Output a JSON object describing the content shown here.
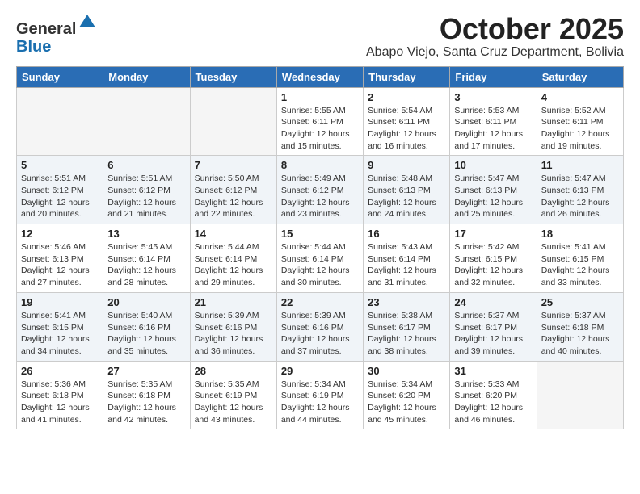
{
  "logo": {
    "general": "General",
    "blue": "Blue"
  },
  "title": "October 2025",
  "location": "Abapo Viejo, Santa Cruz Department, Bolivia",
  "days_of_week": [
    "Sunday",
    "Monday",
    "Tuesday",
    "Wednesday",
    "Thursday",
    "Friday",
    "Saturday"
  ],
  "weeks": [
    [
      {
        "day": "",
        "info": ""
      },
      {
        "day": "",
        "info": ""
      },
      {
        "day": "",
        "info": ""
      },
      {
        "day": "1",
        "info": "Sunrise: 5:55 AM\nSunset: 6:11 PM\nDaylight: 12 hours\nand 15 minutes."
      },
      {
        "day": "2",
        "info": "Sunrise: 5:54 AM\nSunset: 6:11 PM\nDaylight: 12 hours\nand 16 minutes."
      },
      {
        "day": "3",
        "info": "Sunrise: 5:53 AM\nSunset: 6:11 PM\nDaylight: 12 hours\nand 17 minutes."
      },
      {
        "day": "4",
        "info": "Sunrise: 5:52 AM\nSunset: 6:11 PM\nDaylight: 12 hours\nand 19 minutes."
      }
    ],
    [
      {
        "day": "5",
        "info": "Sunrise: 5:51 AM\nSunset: 6:12 PM\nDaylight: 12 hours\nand 20 minutes."
      },
      {
        "day": "6",
        "info": "Sunrise: 5:51 AM\nSunset: 6:12 PM\nDaylight: 12 hours\nand 21 minutes."
      },
      {
        "day": "7",
        "info": "Sunrise: 5:50 AM\nSunset: 6:12 PM\nDaylight: 12 hours\nand 22 minutes."
      },
      {
        "day": "8",
        "info": "Sunrise: 5:49 AM\nSunset: 6:12 PM\nDaylight: 12 hours\nand 23 minutes."
      },
      {
        "day": "9",
        "info": "Sunrise: 5:48 AM\nSunset: 6:13 PM\nDaylight: 12 hours\nand 24 minutes."
      },
      {
        "day": "10",
        "info": "Sunrise: 5:47 AM\nSunset: 6:13 PM\nDaylight: 12 hours\nand 25 minutes."
      },
      {
        "day": "11",
        "info": "Sunrise: 5:47 AM\nSunset: 6:13 PM\nDaylight: 12 hours\nand 26 minutes."
      }
    ],
    [
      {
        "day": "12",
        "info": "Sunrise: 5:46 AM\nSunset: 6:13 PM\nDaylight: 12 hours\nand 27 minutes."
      },
      {
        "day": "13",
        "info": "Sunrise: 5:45 AM\nSunset: 6:14 PM\nDaylight: 12 hours\nand 28 minutes."
      },
      {
        "day": "14",
        "info": "Sunrise: 5:44 AM\nSunset: 6:14 PM\nDaylight: 12 hours\nand 29 minutes."
      },
      {
        "day": "15",
        "info": "Sunrise: 5:44 AM\nSunset: 6:14 PM\nDaylight: 12 hours\nand 30 minutes."
      },
      {
        "day": "16",
        "info": "Sunrise: 5:43 AM\nSunset: 6:14 PM\nDaylight: 12 hours\nand 31 minutes."
      },
      {
        "day": "17",
        "info": "Sunrise: 5:42 AM\nSunset: 6:15 PM\nDaylight: 12 hours\nand 32 minutes."
      },
      {
        "day": "18",
        "info": "Sunrise: 5:41 AM\nSunset: 6:15 PM\nDaylight: 12 hours\nand 33 minutes."
      }
    ],
    [
      {
        "day": "19",
        "info": "Sunrise: 5:41 AM\nSunset: 6:15 PM\nDaylight: 12 hours\nand 34 minutes."
      },
      {
        "day": "20",
        "info": "Sunrise: 5:40 AM\nSunset: 6:16 PM\nDaylight: 12 hours\nand 35 minutes."
      },
      {
        "day": "21",
        "info": "Sunrise: 5:39 AM\nSunset: 6:16 PM\nDaylight: 12 hours\nand 36 minutes."
      },
      {
        "day": "22",
        "info": "Sunrise: 5:39 AM\nSunset: 6:16 PM\nDaylight: 12 hours\nand 37 minutes."
      },
      {
        "day": "23",
        "info": "Sunrise: 5:38 AM\nSunset: 6:17 PM\nDaylight: 12 hours\nand 38 minutes."
      },
      {
        "day": "24",
        "info": "Sunrise: 5:37 AM\nSunset: 6:17 PM\nDaylight: 12 hours\nand 39 minutes."
      },
      {
        "day": "25",
        "info": "Sunrise: 5:37 AM\nSunset: 6:18 PM\nDaylight: 12 hours\nand 40 minutes."
      }
    ],
    [
      {
        "day": "26",
        "info": "Sunrise: 5:36 AM\nSunset: 6:18 PM\nDaylight: 12 hours\nand 41 minutes."
      },
      {
        "day": "27",
        "info": "Sunrise: 5:35 AM\nSunset: 6:18 PM\nDaylight: 12 hours\nand 42 minutes."
      },
      {
        "day": "28",
        "info": "Sunrise: 5:35 AM\nSunset: 6:19 PM\nDaylight: 12 hours\nand 43 minutes."
      },
      {
        "day": "29",
        "info": "Sunrise: 5:34 AM\nSunset: 6:19 PM\nDaylight: 12 hours\nand 44 minutes."
      },
      {
        "day": "30",
        "info": "Sunrise: 5:34 AM\nSunset: 6:20 PM\nDaylight: 12 hours\nand 45 minutes."
      },
      {
        "day": "31",
        "info": "Sunrise: 5:33 AM\nSunset: 6:20 PM\nDaylight: 12 hours\nand 46 minutes."
      },
      {
        "day": "",
        "info": ""
      }
    ]
  ]
}
